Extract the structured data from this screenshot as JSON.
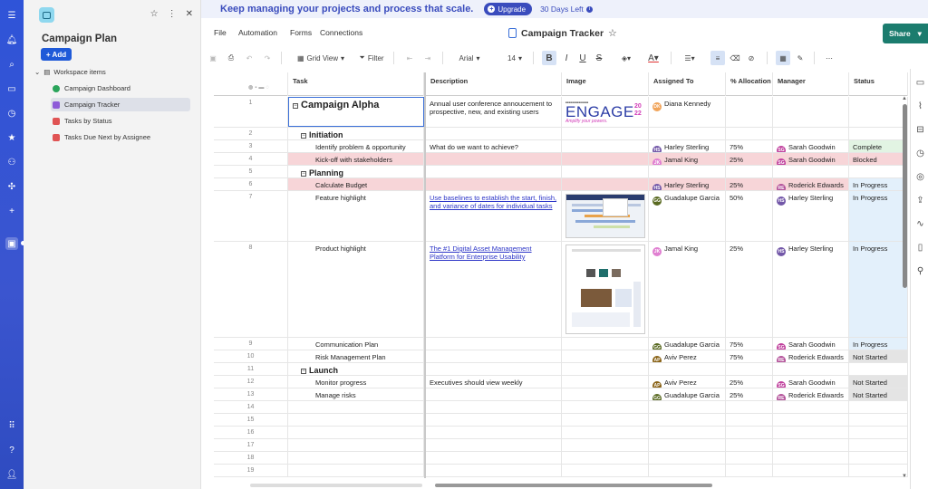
{
  "sidebar": {
    "title": "Campaign Plan",
    "add_label": "Add",
    "workspace_label": "Workspace items",
    "items": [
      {
        "label": "Campaign Dashboard",
        "color": "#2aa45a"
      },
      {
        "label": "Campaign Tracker",
        "color": "#8e5cd8"
      },
      {
        "label": "Tasks by Status",
        "color": "#e05353"
      },
      {
        "label": "Tasks Due Next by Assignee",
        "color": "#e05353"
      }
    ]
  },
  "banner": {
    "message": "Keep managing your projects and process that scale.",
    "upgrade_label": "Upgrade",
    "days_left": "30 Days Left"
  },
  "menu": {
    "file": "File",
    "automation": "Automation",
    "forms": "Forms",
    "connections": "Connections",
    "sheet_title": "Campaign Tracker",
    "share_label": "Share"
  },
  "toolbar": {
    "grid_view": "Grid View",
    "filter": "Filter",
    "font": "Arial",
    "size": "14"
  },
  "columns": [
    "Task",
    "Description",
    "Image",
    "Assigned To",
    "% Allocation",
    "Manager",
    "Status"
  ],
  "rows": [
    {
      "num": "1",
      "task": "Campaign Alpha",
      "level": 0,
      "desc": "Annual user conference annoucement to prospective, new, and existing users",
      "assigned": "Diana Kennedy",
      "assigned_initials": "DK",
      "alloc": "",
      "manager": "",
      "manager_initials": "",
      "status": ""
    },
    {
      "num": "2",
      "task": "Initiation",
      "level": 1,
      "desc": "",
      "assigned": "",
      "alloc": "",
      "manager": "",
      "status": ""
    },
    {
      "num": "3",
      "task": "Identify problem & opportunity",
      "level": 2,
      "desc": "What do we want to achieve?",
      "assigned": "Harley Sterling",
      "assigned_initials": "HS",
      "alloc": "75%",
      "manager": "Sarah Goodwin",
      "manager_initials": "SG",
      "status": "Complete"
    },
    {
      "num": "4",
      "task": "Kick-off with stakeholders",
      "level": 2,
      "desc": "",
      "assigned": "Jamal King",
      "assigned_initials": "JK",
      "alloc": "25%",
      "manager": "Sarah Goodwin",
      "manager_initials": "SG",
      "status": "Blocked"
    },
    {
      "num": "5",
      "task": "Planning",
      "level": 1,
      "desc": "",
      "assigned": "",
      "alloc": "",
      "manager": "",
      "status": ""
    },
    {
      "num": "6",
      "task": "Calculate Budget",
      "level": 2,
      "desc": "",
      "assigned": "Harley Sterling",
      "assigned_initials": "HS",
      "alloc": "25%",
      "manager": "Roderick Edwards",
      "manager_initials": "RE",
      "status": "In Progress"
    },
    {
      "num": "7",
      "task": "Feature highlight",
      "level": 2,
      "desc": "Use baselines to establish the start, finish, and variance of dates for individual tasks",
      "assigned": "Guadalupe Garcia",
      "assigned_initials": "GG",
      "alloc": "50%",
      "manager": "Harley Sterling",
      "manager_initials": "HS",
      "status": "In Progress"
    },
    {
      "num": "8",
      "task": "Product highlight",
      "level": 2,
      "desc": "The #1 Digital Asset Management Platform for Enterprise Usability",
      "assigned": "Jamal King",
      "assigned_initials": "JK",
      "alloc": "25%",
      "manager": "Harley Sterling",
      "manager_initials": "HS",
      "status": "In Progress"
    },
    {
      "num": "9",
      "task": "Communication Plan",
      "level": 2,
      "desc": "",
      "assigned": "Guadalupe Garcia",
      "assigned_initials": "GG",
      "alloc": "75%",
      "manager": "Sarah Goodwin",
      "manager_initials": "SG",
      "status": "In Progress"
    },
    {
      "num": "10",
      "task": "Risk Management Plan",
      "level": 2,
      "desc": "",
      "assigned": "Aviv Perez",
      "assigned_initials": "AP",
      "alloc": "75%",
      "manager": "Roderick Edwards",
      "manager_initials": "RE",
      "status": "Not Started"
    },
    {
      "num": "11",
      "task": "Launch",
      "level": 1,
      "desc": "",
      "assigned": "",
      "alloc": "",
      "manager": "",
      "status": ""
    },
    {
      "num": "12",
      "task": "Monitor progress",
      "level": 2,
      "desc": "Executives should view weekly",
      "assigned": "Aviv Perez",
      "assigned_initials": "AP",
      "alloc": "25%",
      "manager": "Sarah Goodwin",
      "manager_initials": "SG",
      "status": "Not Started"
    },
    {
      "num": "13",
      "task": "Manage risks",
      "level": 2,
      "desc": "",
      "assigned": "Guadalupe Garcia",
      "assigned_initials": "GG",
      "alloc": "25%",
      "manager": "Roderick Edwards",
      "manager_initials": "RE",
      "status": "Not Started"
    },
    {
      "num": "14"
    },
    {
      "num": "15"
    },
    {
      "num": "16"
    },
    {
      "num": "17"
    },
    {
      "num": "18"
    },
    {
      "num": "19"
    }
  ],
  "engage_image": {
    "headline": "ENGAGE",
    "year_top": "20",
    "year_bottom": "22",
    "tagline": "Amplify your powers."
  }
}
